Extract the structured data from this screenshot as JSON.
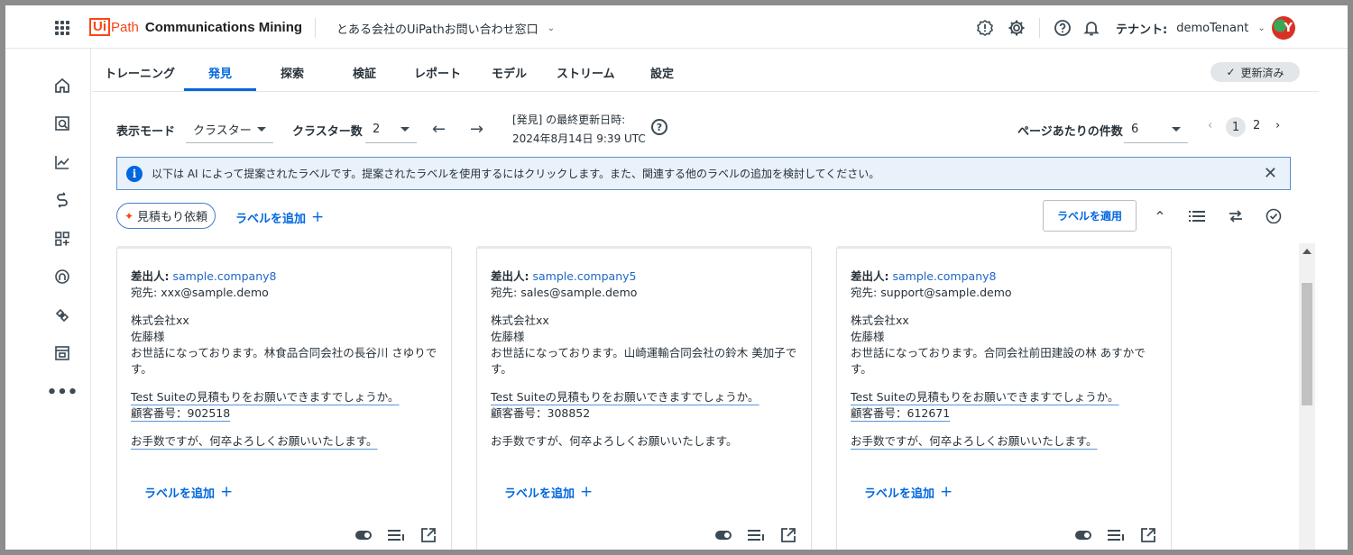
{
  "header": {
    "logo_ui": "Ui",
    "logo_path": "Path",
    "app_name": "Communications Mining",
    "project": "とある会社のUiPathお問い合わせ窓口",
    "tenant_label": "テナント:",
    "tenant_name": "demoTenant",
    "avatar_letter": "Y"
  },
  "tabs": [
    "トレーニング",
    "発見",
    "探索",
    "検証",
    "レポート",
    "モデル",
    "ストリーム",
    "設定"
  ],
  "active_tab": "発見",
  "updated_badge": "更新済み",
  "toolbar": {
    "display_mode_label": "表示モード",
    "display_mode_value": "クラスター",
    "cluster_count_label": "クラスター数",
    "cluster_count_value": "2",
    "update_title": "[発見] の最終更新日時:",
    "update_time": "2024年8月14日 9:39 UTC",
    "per_page_label": "ページあたりの件数",
    "per_page_value": "6",
    "pages": [
      "1",
      "2"
    ],
    "current_page": "1"
  },
  "banner": {
    "text": "以下は AI によって提案されたラベルです。提案されたラベルを使用するにはクリックします。また、関連する他のラベルの追加を検討してください。"
  },
  "labels": {
    "suggested_chip": "見積もり依頼",
    "add_label": "ラベルを追加",
    "apply_button": "ラベルを適用"
  },
  "cards": [
    {
      "from_label": "差出人:",
      "from": "sample.company8",
      "to_label": "宛先:",
      "to": "xxx@sample.demo",
      "line1": "株式会社xx",
      "line2": "佐藤様",
      "line3a": "お世話になっております。林食品合同会社の長谷川 さゆりで",
      "line3b": "す。",
      "line4": "Test Suiteの見積もりをお願いできますでしょうか。",
      "line5": "顧客番号：902518",
      "line6": "お手数ですが、何卒よろしくお願いいたします。",
      "add_label": "ラベルを追加"
    },
    {
      "from_label": "差出人:",
      "from": "sample.company5",
      "to_label": "宛先:",
      "to": "sales@sample.demo",
      "line1": "株式会社xx",
      "line2": "佐藤様",
      "line3a": "お世話になっております。山崎運輸合同会社の鈴木 美加子で",
      "line3b": "す。",
      "line4": "Test Suiteの見積もりをお願いできますでしょうか。",
      "line5": "顧客番号：308852",
      "line6": "お手数ですが、何卒よろしくお願いいたします。",
      "add_label": "ラベルを追加"
    },
    {
      "from_label": "差出人:",
      "from": "sample.company8",
      "to_label": "宛先:",
      "to": "support@sample.demo",
      "line1": "株式会社xx",
      "line2": "佐藤様",
      "line3a": "お世話になっております。合同会社前田建設の林 あすかで",
      "line3b": "す。",
      "line4": "Test Suiteの見積もりをお願いできますでしょうか。",
      "line5": "顧客番号：612671",
      "line6": "お手数ですが、何卒よろしくお願いいたします。",
      "add_label": "ラベルを追加"
    }
  ],
  "colors": {
    "accent": "#0067df",
    "brand": "#fa4616",
    "banner_bg": "#e9f1fa"
  }
}
